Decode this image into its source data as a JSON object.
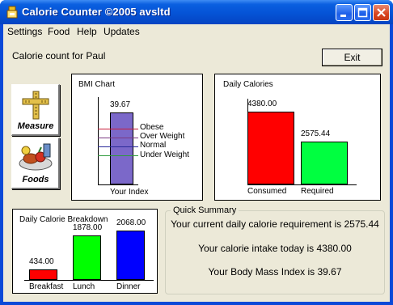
{
  "window": {
    "title": "Calorie Counter ©2005 avsltd"
  },
  "menu": [
    "Settings",
    "Food",
    "Help",
    "Updates"
  ],
  "header": {
    "user_label": "Calorie count for Paul",
    "exit_label": "Exit"
  },
  "sidebar": {
    "measure_label": "Measure",
    "foods_label": "Foods"
  },
  "bmi_chart": {
    "title": "BMI Chart",
    "value_label": "39.67",
    "value": 39.67,
    "x_label": "Your Index",
    "bands": [
      {
        "label": "Obese",
        "color": "#c81e3c"
      },
      {
        "label": "Over Weight",
        "color": "#7a3a82"
      },
      {
        "label": "Normal",
        "color": "#2a2a9a"
      },
      {
        "label": "Under Weight",
        "color": "#2e9a3c"
      }
    ],
    "bar_color": "#7b68c9"
  },
  "daily_calories": {
    "title": "Daily Calories",
    "bars": [
      {
        "name": "Consumed",
        "value": 4380.0,
        "label": "4380.00",
        "color": "#ff0000"
      },
      {
        "name": "Required",
        "value": 2575.44,
        "label": "2575.44",
        "color": "#00ff40"
      }
    ],
    "max": 4380
  },
  "breakdown": {
    "title": "Daily Calorie Breakdown",
    "bars": [
      {
        "name": "Breakfast",
        "value": 434.0,
        "label": "434.00",
        "color": "#ff0000"
      },
      {
        "name": "Lunch",
        "value": 1878.0,
        "label": "1878.00",
        "color": "#00ff00"
      },
      {
        "name": "Dinner",
        "value": 2068.0,
        "label": "2068.00",
        "color": "#0000ff"
      }
    ],
    "max": 2068
  },
  "summary": {
    "title": "Quick Summary",
    "line1": "Your current daily calorie requirement is 2575.44",
    "line2": "Your calorie intake today is 4380.00",
    "line3": "Your Body Mass Index is 39.67"
  }
}
